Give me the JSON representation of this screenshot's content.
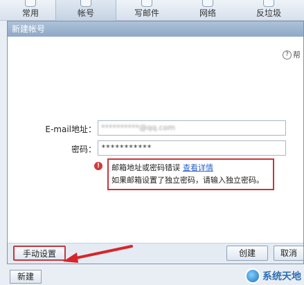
{
  "topbar": {
    "tabs": [
      {
        "label": "常用",
        "icon": "home-icon"
      },
      {
        "label": "帐号",
        "icon": "account-icon"
      },
      {
        "label": "写邮件",
        "icon": "compose-icon"
      },
      {
        "label": "网络",
        "icon": "network-icon"
      },
      {
        "label": "反垃圾",
        "icon": "shield-icon"
      }
    ],
    "active_tab": "帐号"
  },
  "dialog": {
    "title": "新建帐号",
    "help_label": "帮",
    "email_label": "E-mail地址：",
    "email_value": "**********@qq.com",
    "password_label": "密码：",
    "password_value": "***********",
    "error": {
      "line1": "邮箱地址或密码错误",
      "link": "查看详情",
      "line2": "如果邮箱设置了独立密码，请输入独立密码。"
    },
    "buttons": {
      "manual": "手动设置",
      "create": "创建",
      "cancel": "取消"
    }
  },
  "new_button": "新建",
  "watermark": "系统天地",
  "colors": {
    "error_border": "#c8343b",
    "link": "#2b60c8",
    "title_bar": "#8ea8c6"
  }
}
